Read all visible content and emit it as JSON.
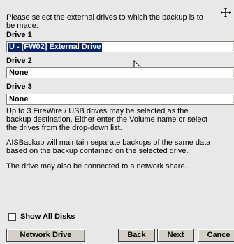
{
  "intro": {
    "line1": "Please select the external drives to which the backup is to",
    "line2": "be made:"
  },
  "drives": [
    {
      "label": "Drive 1",
      "value": "U - [FW02] External Drive",
      "selected": true
    },
    {
      "label": "Drive 2",
      "value": "None",
      "selected": false
    },
    {
      "label": "Drive 3",
      "value": "None",
      "selected": false
    }
  ],
  "info": {
    "para1": [
      "Up to 3 FireWire / USB drives may be selected as the",
      "backup destination. Either enter the Volume name or select",
      "the drives from the drop-down list."
    ],
    "para2": [
      "AISBackup will maintain separate backups of the same data",
      "based on the backup contained on the selected drive."
    ],
    "para3": "The drive may also be connected to a network share."
  },
  "show_all_disks": {
    "label": "Show All Disks",
    "checked": false
  },
  "buttons": {
    "network_drive": {
      "pre": "Ne",
      "key": "t",
      "post": "work Drive"
    },
    "back": {
      "pre": "",
      "key": "B",
      "post": "ack"
    },
    "next": {
      "pre": "",
      "key": "N",
      "post": "ext"
    },
    "cancel": {
      "pre": "",
      "key": "C",
      "post": "ance"
    }
  },
  "colors": {
    "selection": "#0a246a",
    "dialog_bg": "#e8e8e8"
  }
}
